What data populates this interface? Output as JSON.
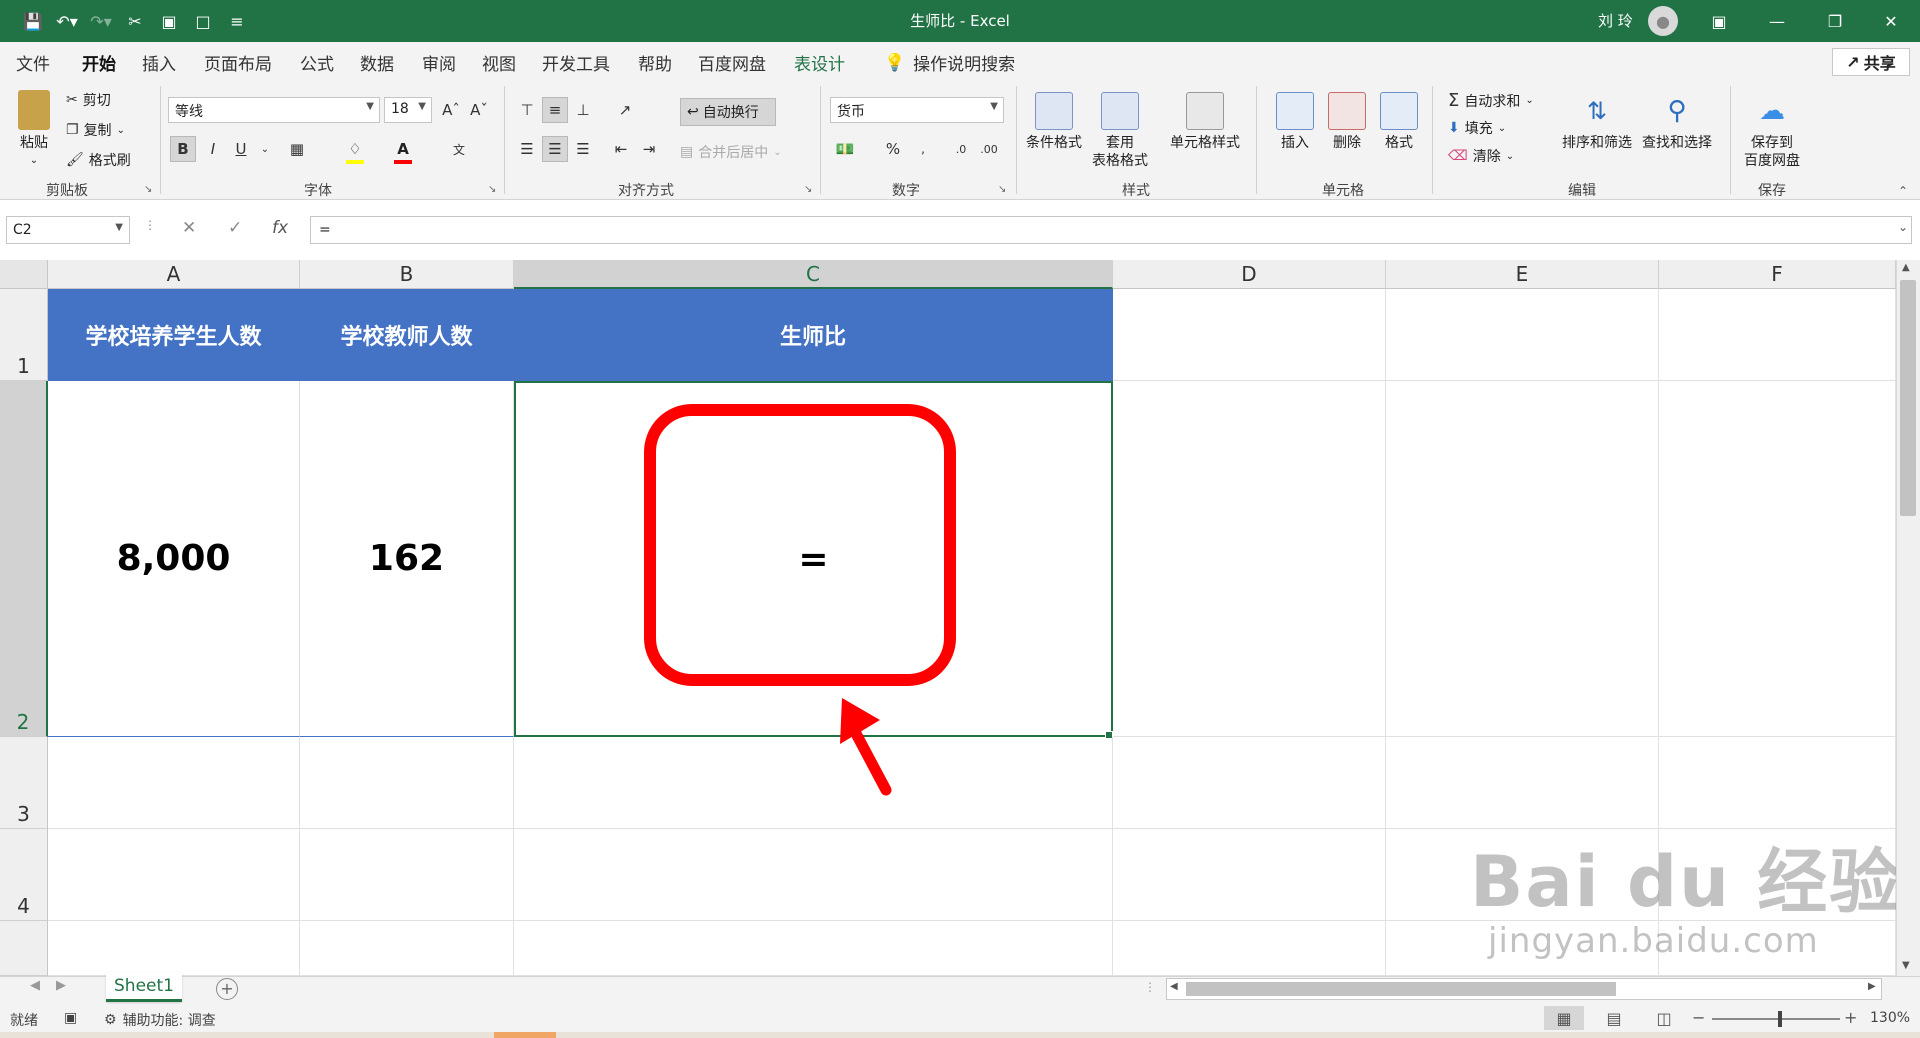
{
  "window": {
    "title": "生师比  -  Excel",
    "user": "刘 玲"
  },
  "qat": {
    "save": "save-icon",
    "undo": "undo-icon",
    "redo": "redo-icon"
  },
  "tabs": [
    {
      "label": "文件"
    },
    {
      "label": "开始"
    },
    {
      "label": "插入"
    },
    {
      "label": "页面布局"
    },
    {
      "label": "公式"
    },
    {
      "label": "数据"
    },
    {
      "label": "审阅"
    },
    {
      "label": "视图"
    },
    {
      "label": "开发工具"
    },
    {
      "label": "帮助"
    },
    {
      "label": "百度网盘"
    },
    {
      "label": "表设计"
    }
  ],
  "tell_me": "操作说明搜索",
  "share": "共享",
  "ribbon": {
    "clipboard": {
      "paste": "粘贴",
      "cut": "剪切",
      "copy": "复制",
      "format_painter": "格式刷",
      "label": "剪贴板"
    },
    "font": {
      "name": "等线",
      "size": "18",
      "label": "字体",
      "bold": "B",
      "italic": "I",
      "underline": "U",
      "font_color_glyph": "A",
      "wen": "文"
    },
    "alignment": {
      "wrap": "自动换行",
      "merge": "合并后居中",
      "label": "对齐方式"
    },
    "number": {
      "format": "货币",
      "percent": "%",
      "label": "数字"
    },
    "styles": {
      "cond": "条件格式",
      "table1": "套用",
      "table2": "表格格式",
      "cell": "单元格样式",
      "label": "样式"
    },
    "cells": {
      "insert": "插入",
      "delete": "删除",
      "format": "格式",
      "label": "单元格"
    },
    "editing": {
      "autosum": "自动求和",
      "fill": "填充",
      "clear": "清除",
      "sort": "排序和筛选",
      "find": "查找和选择",
      "label": "编辑"
    },
    "save": {
      "save1": "保存到",
      "save2": "百度网盘",
      "label": "保存"
    }
  },
  "formula_bar": {
    "name_box": "C2",
    "formula": "=",
    "fx": "fx"
  },
  "columns": [
    "A",
    "B",
    "C",
    "D",
    "E",
    "F"
  ],
  "rows": [
    "1",
    "2",
    "3",
    "4"
  ],
  "table": {
    "headers": [
      "学校培养学生人数",
      "学校教师人数",
      "生师比"
    ],
    "values": [
      "8,000",
      "162",
      "="
    ]
  },
  "sheet": {
    "tab": "Sheet1"
  },
  "status": {
    "ready": "就绪",
    "accessibility": "辅助功能: 调查",
    "zoom": "130%"
  },
  "watermark": {
    "line1": "Bai du 经验",
    "line2": "jingyan.baidu.com"
  },
  "colors": {
    "brand": "#217346",
    "header_fill": "#4472c4",
    "callout": "#ff0000"
  }
}
